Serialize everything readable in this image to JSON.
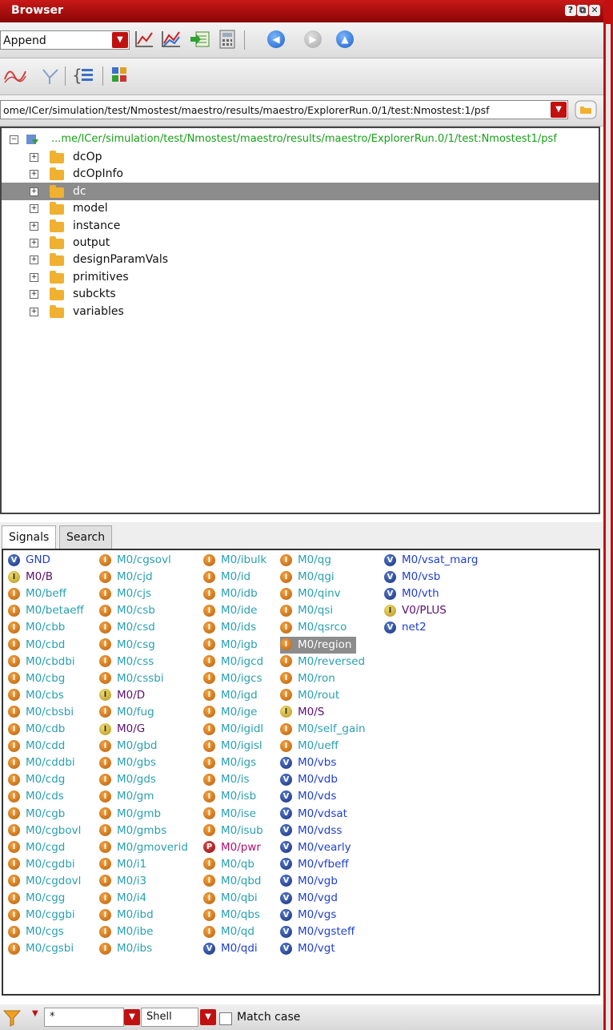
{
  "window": {
    "title": "Browser",
    "buttons": [
      "?",
      "⧉",
      "✕"
    ]
  },
  "toolbar1": {
    "mode_value": "Append",
    "icons": [
      "plot-icon",
      "multi-plot-icon",
      "export-icon",
      "calculator-icon",
      "back-icon",
      "forward-icon",
      "up-icon"
    ]
  },
  "toolbar2": {
    "icons": [
      "waveform-icon",
      "cursor-icon",
      "expand-list-icon",
      "grid-icon"
    ]
  },
  "path": {
    "value": "ome/ICer/simulation/test/Nmostest/maestro/results/maestro/ExplorerRun.0/1/test:Nmostest:1/psf"
  },
  "tree": {
    "root_label": "...me/ICer/simulation/test/Nmostest/maestro/results/maestro/ExplorerRun.0/1/test:Nmostest1/psf",
    "items": [
      {
        "label": "dcOp",
        "selected": false
      },
      {
        "label": "dcOpInfo",
        "selected": false
      },
      {
        "label": "dc",
        "selected": true
      },
      {
        "label": "model",
        "selected": false
      },
      {
        "label": "instance",
        "selected": false
      },
      {
        "label": "output",
        "selected": false
      },
      {
        "label": "designParamVals",
        "selected": false
      },
      {
        "label": "primitives",
        "selected": false
      },
      {
        "label": "subckts",
        "selected": false
      },
      {
        "label": "variables",
        "selected": false
      }
    ]
  },
  "tabs": [
    {
      "label": "Signals",
      "active": true
    },
    {
      "label": "Search",
      "active": false
    }
  ],
  "signals": {
    "columns": [
      [
        {
          "name": "GND",
          "type": "V"
        },
        {
          "name": "M0/B",
          "type": "Y"
        },
        {
          "name": "M0/beff",
          "type": "I"
        },
        {
          "name": "M0/betaeff",
          "type": "I"
        },
        {
          "name": "M0/cbb",
          "type": "I"
        },
        {
          "name": "M0/cbd",
          "type": "I"
        },
        {
          "name": "M0/cbdbi",
          "type": "I"
        },
        {
          "name": "M0/cbg",
          "type": "I"
        },
        {
          "name": "M0/cbs",
          "type": "I"
        },
        {
          "name": "M0/cbsbi",
          "type": "I"
        },
        {
          "name": "M0/cdb",
          "type": "I"
        },
        {
          "name": "M0/cdd",
          "type": "I"
        },
        {
          "name": "M0/cddbi",
          "type": "I"
        },
        {
          "name": "M0/cdg",
          "type": "I"
        },
        {
          "name": "M0/cds",
          "type": "I"
        },
        {
          "name": "M0/cgb",
          "type": "I"
        },
        {
          "name": "M0/cgbovl",
          "type": "I"
        },
        {
          "name": "M0/cgd",
          "type": "I"
        },
        {
          "name": "M0/cgdbi",
          "type": "I"
        },
        {
          "name": "M0/cgdovl",
          "type": "I"
        },
        {
          "name": "M0/cgg",
          "type": "I"
        },
        {
          "name": "M0/cggbi",
          "type": "I"
        },
        {
          "name": "M0/cgs",
          "type": "I"
        },
        {
          "name": "M0/cgsbi",
          "type": "I"
        }
      ],
      [
        {
          "name": "M0/cgsovl",
          "type": "I"
        },
        {
          "name": "M0/cjd",
          "type": "I"
        },
        {
          "name": "M0/cjs",
          "type": "I"
        },
        {
          "name": "M0/csb",
          "type": "I"
        },
        {
          "name": "M0/csd",
          "type": "I"
        },
        {
          "name": "M0/csg",
          "type": "I"
        },
        {
          "name": "M0/css",
          "type": "I"
        },
        {
          "name": "M0/cssbi",
          "type": "I"
        },
        {
          "name": "M0/D",
          "type": "Y"
        },
        {
          "name": "M0/fug",
          "type": "I"
        },
        {
          "name": "M0/G",
          "type": "Y"
        },
        {
          "name": "M0/gbd",
          "type": "I"
        },
        {
          "name": "M0/gbs",
          "type": "I"
        },
        {
          "name": "M0/gds",
          "type": "I"
        },
        {
          "name": "M0/gm",
          "type": "I"
        },
        {
          "name": "M0/gmb",
          "type": "I"
        },
        {
          "name": "M0/gmbs",
          "type": "I"
        },
        {
          "name": "M0/gmoverid",
          "type": "I"
        },
        {
          "name": "M0/i1",
          "type": "I"
        },
        {
          "name": "M0/i3",
          "type": "I"
        },
        {
          "name": "M0/i4",
          "type": "I"
        },
        {
          "name": "M0/ibd",
          "type": "I"
        },
        {
          "name": "M0/ibe",
          "type": "I"
        },
        {
          "name": "M0/ibs",
          "type": "I"
        }
      ],
      [
        {
          "name": "M0/ibulk",
          "type": "I"
        },
        {
          "name": "M0/id",
          "type": "I"
        },
        {
          "name": "M0/idb",
          "type": "I"
        },
        {
          "name": "M0/ide",
          "type": "I"
        },
        {
          "name": "M0/ids",
          "type": "I"
        },
        {
          "name": "M0/igb",
          "type": "I"
        },
        {
          "name": "M0/igcd",
          "type": "I"
        },
        {
          "name": "M0/igcs",
          "type": "I"
        },
        {
          "name": "M0/igd",
          "type": "I"
        },
        {
          "name": "M0/ige",
          "type": "I"
        },
        {
          "name": "M0/igidl",
          "type": "I"
        },
        {
          "name": "M0/igisl",
          "type": "I"
        },
        {
          "name": "M0/igs",
          "type": "I"
        },
        {
          "name": "M0/is",
          "type": "I"
        },
        {
          "name": "M0/isb",
          "type": "I"
        },
        {
          "name": "M0/ise",
          "type": "I"
        },
        {
          "name": "M0/isub",
          "type": "I"
        },
        {
          "name": "M0/pwr",
          "type": "P"
        },
        {
          "name": "M0/qb",
          "type": "I"
        },
        {
          "name": "M0/qbd",
          "type": "I"
        },
        {
          "name": "M0/qbi",
          "type": "I"
        },
        {
          "name": "M0/qbs",
          "type": "I"
        },
        {
          "name": "M0/qd",
          "type": "I"
        },
        {
          "name": "M0/qdi",
          "type": "V"
        }
      ],
      [
        {
          "name": "M0/qg",
          "type": "I"
        },
        {
          "name": "M0/qgi",
          "type": "I"
        },
        {
          "name": "M0/qinv",
          "type": "I"
        },
        {
          "name": "M0/qsi",
          "type": "I"
        },
        {
          "name": "M0/qsrco",
          "type": "I"
        },
        {
          "name": "M0/region",
          "type": "I",
          "selected": true
        },
        {
          "name": "M0/reversed",
          "type": "I"
        },
        {
          "name": "M0/ron",
          "type": "I"
        },
        {
          "name": "M0/rout",
          "type": "I"
        },
        {
          "name": "M0/S",
          "type": "Y"
        },
        {
          "name": "M0/self_gain",
          "type": "I"
        },
        {
          "name": "M0/ueff",
          "type": "I"
        },
        {
          "name": "M0/vbs",
          "type": "V"
        },
        {
          "name": "M0/vdb",
          "type": "V"
        },
        {
          "name": "M0/vds",
          "type": "V"
        },
        {
          "name": "M0/vdsat",
          "type": "V"
        },
        {
          "name": "M0/vdss",
          "type": "V"
        },
        {
          "name": "M0/vearly",
          "type": "V"
        },
        {
          "name": "M0/vfbeff",
          "type": "V"
        },
        {
          "name": "M0/vgb",
          "type": "V"
        },
        {
          "name": "M0/vgd",
          "type": "V"
        },
        {
          "name": "M0/vgs",
          "type": "V"
        },
        {
          "name": "M0/vgsteff",
          "type": "V"
        },
        {
          "name": "M0/vgt",
          "type": "V"
        }
      ],
      [
        {
          "name": "M0/vsat_marg",
          "type": "V"
        },
        {
          "name": "M0/vsb",
          "type": "V"
        },
        {
          "name": "M0/vth",
          "type": "V"
        },
        {
          "name": "V0/PLUS",
          "type": "Y"
        },
        {
          "name": "net2",
          "type": "V"
        }
      ]
    ]
  },
  "filter": {
    "value": "*",
    "mode_value": "Shell",
    "match_case_label": "Match case",
    "match_case_checked": false
  },
  "colors": {
    "accent": "#c01010",
    "selection": "#8c8c8c"
  }
}
